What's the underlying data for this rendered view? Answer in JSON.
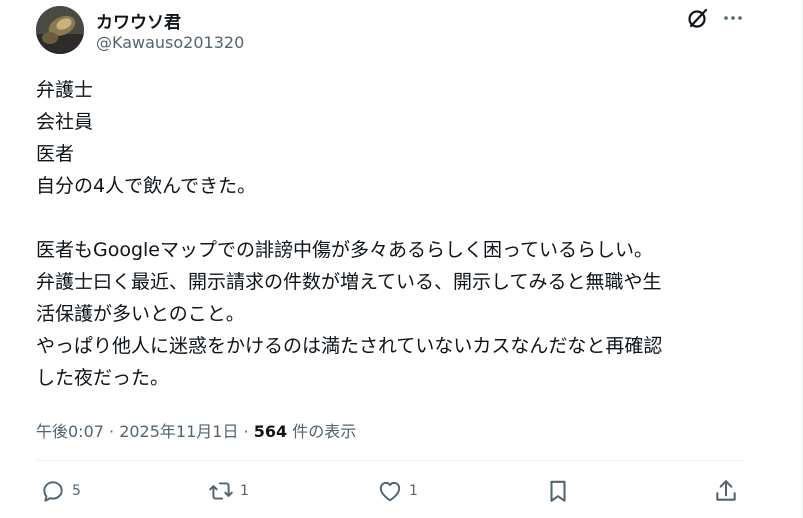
{
  "author": {
    "display_name": "カワウソ君",
    "handle": "@Kawauso201320"
  },
  "tweet": {
    "lines": [
      "弁護士",
      "会社員",
      "医者",
      "自分の4人で飲んできた。",
      "",
      "医者もGoogleマップでの誹謗中傷が多々あるらしく困っているらしい。",
      "弁護士曰く最近、開示請求の件数が増えている、開示してみると無職や生",
      "活保護が多いとのこと。",
      "やっぱり他人に迷惑をかけるのは満たされていないカスなんだなと再確認",
      "した夜だった。"
    ]
  },
  "meta": {
    "timestamp": "午後0:07 · 2025年11月1日 · ",
    "views_count": "564",
    "views_label": " 件の表示"
  },
  "actions": {
    "reply_count": "5",
    "retweet_count": "1",
    "like_count": "1"
  },
  "icons": {
    "grok": "grok-icon",
    "more": "more-icon",
    "reply": "reply-icon",
    "retweet": "retweet-icon",
    "like": "heart-icon",
    "bookmark": "bookmark-icon",
    "share": "share-icon"
  },
  "colors": {
    "text": "#0f1419",
    "secondary": "#536471",
    "divider": "#eff3f4"
  }
}
